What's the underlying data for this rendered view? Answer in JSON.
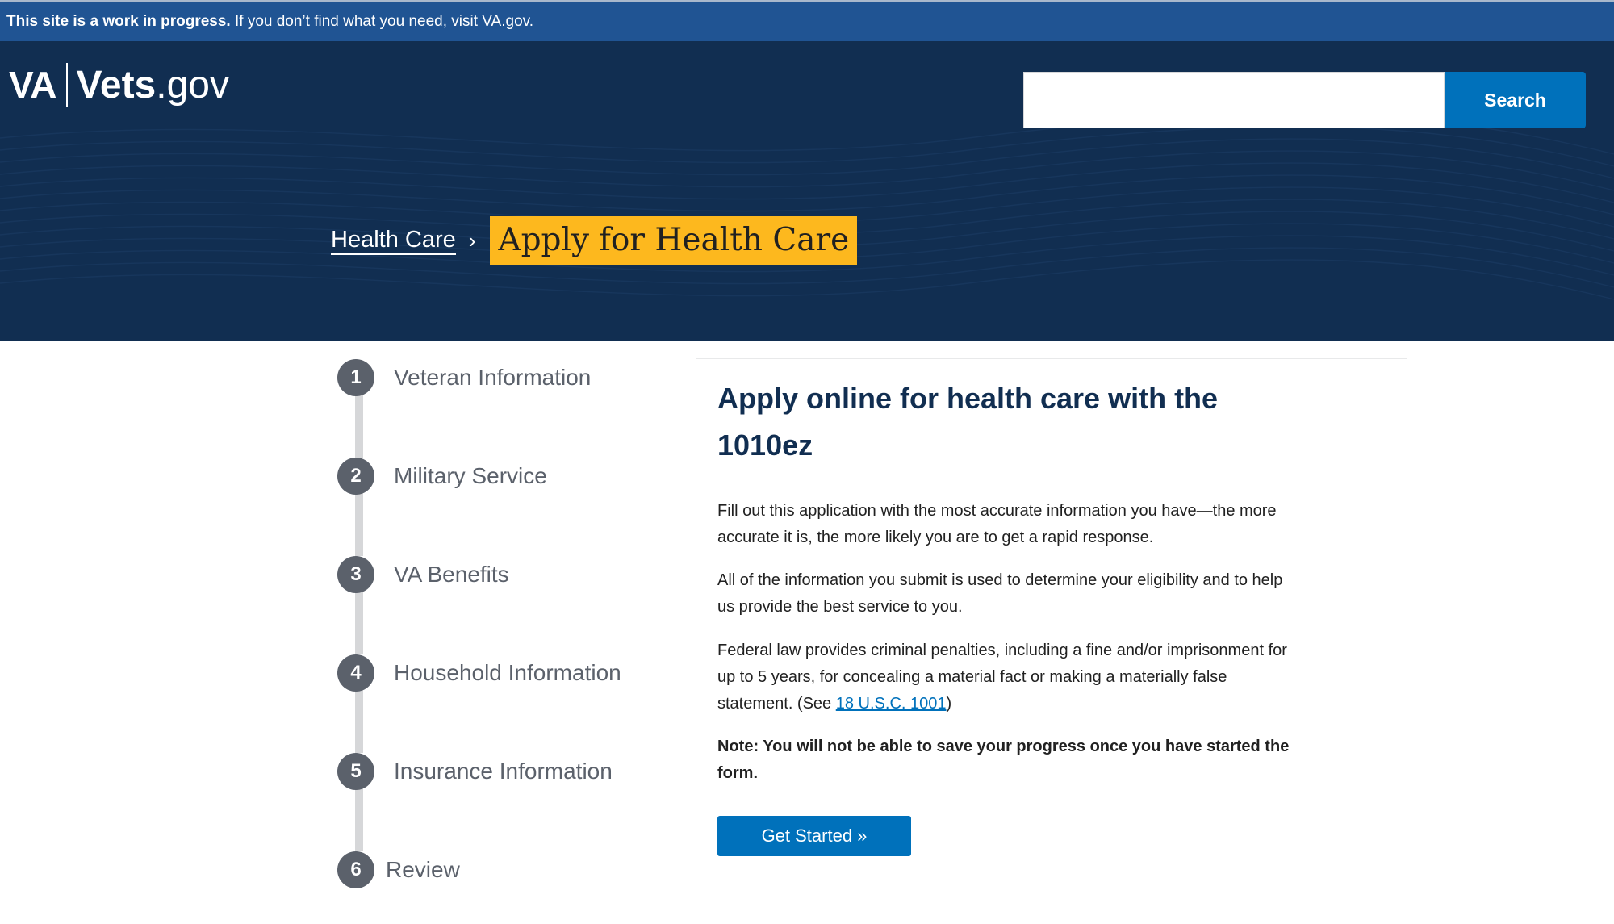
{
  "banner": {
    "lead": "This site is a",
    "link": "work in progress.",
    "middle": "If you don’t find what you need, visit",
    "va_link": "VA.gov",
    "end": "."
  },
  "header": {
    "logo_va": "VA",
    "logo_vets": "Vets",
    "logo_gov": ".gov",
    "search_placeholder": "",
    "search_button": "Search"
  },
  "breadcrumb": {
    "parent": "Health Care",
    "separator": "›",
    "current": "Apply for Health Care"
  },
  "steps": [
    {
      "number": "1",
      "label": "Veteran Information"
    },
    {
      "number": "2",
      "label": "Military Service"
    },
    {
      "number": "3",
      "label": "VA Benefits"
    },
    {
      "number": "4",
      "label": "Household Information"
    },
    {
      "number": "5",
      "label": "Insurance Information"
    },
    {
      "number": "6",
      "label": "Review"
    }
  ],
  "intro": {
    "title": "Apply online for health care with the 1010ez",
    "para1": "Fill out this application with the most accurate information you have—the more accurate it is, the more likely you are to get a rapid response.",
    "para2": "All of the information you submit is used to determine your eligibility and to help us provide the best service to you.",
    "para3_before": "Federal law provides criminal penalties, including a fine and/or imprisonment for up to 5 years, for concealing a material fact or making a materially false statement. (See ",
    "para3_link": "18 U.S.C. 1001",
    "para3_after": ")",
    "note": "Note: You will not be able to save your progress once you have started the form.",
    "button": "Get Started »"
  },
  "colors": {
    "banner": "#205493",
    "header": "#112e51",
    "primary": "#0071bb",
    "highlight": "#fdb81e",
    "step": "#5b616b"
  }
}
